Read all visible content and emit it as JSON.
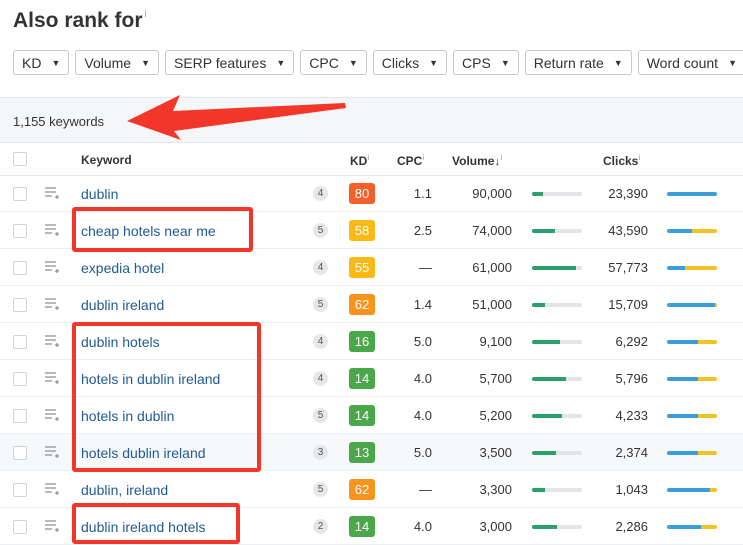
{
  "title": "Also rank for",
  "title_info": "i",
  "filters": [
    "KD",
    "Volume",
    "SERP features",
    "CPC",
    "Clicks",
    "CPS",
    "Return rate",
    "Word count"
  ],
  "keyword_count": "1,155 keywords",
  "columns": {
    "keyword": "Keyword",
    "kd": "KD",
    "cpc": "CPC",
    "volume": "Volume",
    "volume_sort": "↓",
    "clicks": "Clicks",
    "info": "i"
  },
  "colors": {
    "kd_red": "#f4602b",
    "kd_orange": "#f7941d",
    "kd_yellow": "#fbb917",
    "kd_green": "#4aa84a",
    "annotation": "#f2362a",
    "link": "#1f5a96"
  },
  "rows": [
    {
      "keyword": "dublin",
      "parent": "4",
      "kd": "80",
      "kd_color": "#f4602b",
      "cpc": "1.1",
      "volume": "90,000",
      "volume_fill": 0.22,
      "clicks": "23,390",
      "clicks_blue": 1.0
    },
    {
      "keyword": "cheap hotels near me",
      "parent": "5",
      "kd": "58",
      "kd_color": "#fbb917",
      "cpc": "2.5",
      "volume": "74,000",
      "volume_fill": 0.45,
      "clicks": "43,590",
      "clicks_blue": 0.5
    },
    {
      "keyword": "expedia hotel",
      "parent": "4",
      "kd": "55",
      "kd_color": "#fbb917",
      "cpc": "—",
      "volume": "61,000",
      "volume_fill": 0.88,
      "clicks": "57,773",
      "clicks_blue": 0.35
    },
    {
      "keyword": "dublin ireland",
      "parent": "5",
      "kd": "62",
      "kd_color": "#f7941d",
      "cpc": "1.4",
      "volume": "51,000",
      "volume_fill": 0.25,
      "clicks": "15,709",
      "clicks_blue": 0.95
    },
    {
      "keyword": "dublin hotels",
      "parent": "4",
      "kd": "16",
      "kd_color": "#4aa84a",
      "cpc": "5.0",
      "volume": "9,100",
      "volume_fill": 0.55,
      "clicks": "6,292",
      "clicks_blue": 0.62
    },
    {
      "keyword": "hotels in dublin ireland",
      "parent": "4",
      "kd": "14",
      "kd_color": "#4aa84a",
      "cpc": "4.0",
      "volume": "5,700",
      "volume_fill": 0.68,
      "clicks": "5,796",
      "clicks_blue": 0.62
    },
    {
      "keyword": "hotels in dublin",
      "parent": "5",
      "kd": "14",
      "kd_color": "#4aa84a",
      "cpc": "4.0",
      "volume": "5,200",
      "volume_fill": 0.6,
      "clicks": "4,233",
      "clicks_blue": 0.62
    },
    {
      "keyword": "hotels dublin ireland",
      "parent": "3",
      "kd": "13",
      "kd_color": "#4aa84a",
      "cpc": "5.0",
      "volume": "3,500",
      "volume_fill": 0.48,
      "clicks": "2,374",
      "clicks_blue": 0.62
    },
    {
      "keyword": "dublin, ireland",
      "parent": "5",
      "kd": "62",
      "kd_color": "#f7941d",
      "cpc": "—",
      "volume": "3,300",
      "volume_fill": 0.26,
      "clicks": "1,043",
      "clicks_blue": 0.85
    },
    {
      "keyword": "dublin ireland hotels",
      "parent": "2",
      "kd": "14",
      "kd_color": "#4aa84a",
      "cpc": "4.0",
      "volume": "3,000",
      "volume_fill": 0.5,
      "clicks": "2,286",
      "clicks_blue": 0.68
    }
  ]
}
